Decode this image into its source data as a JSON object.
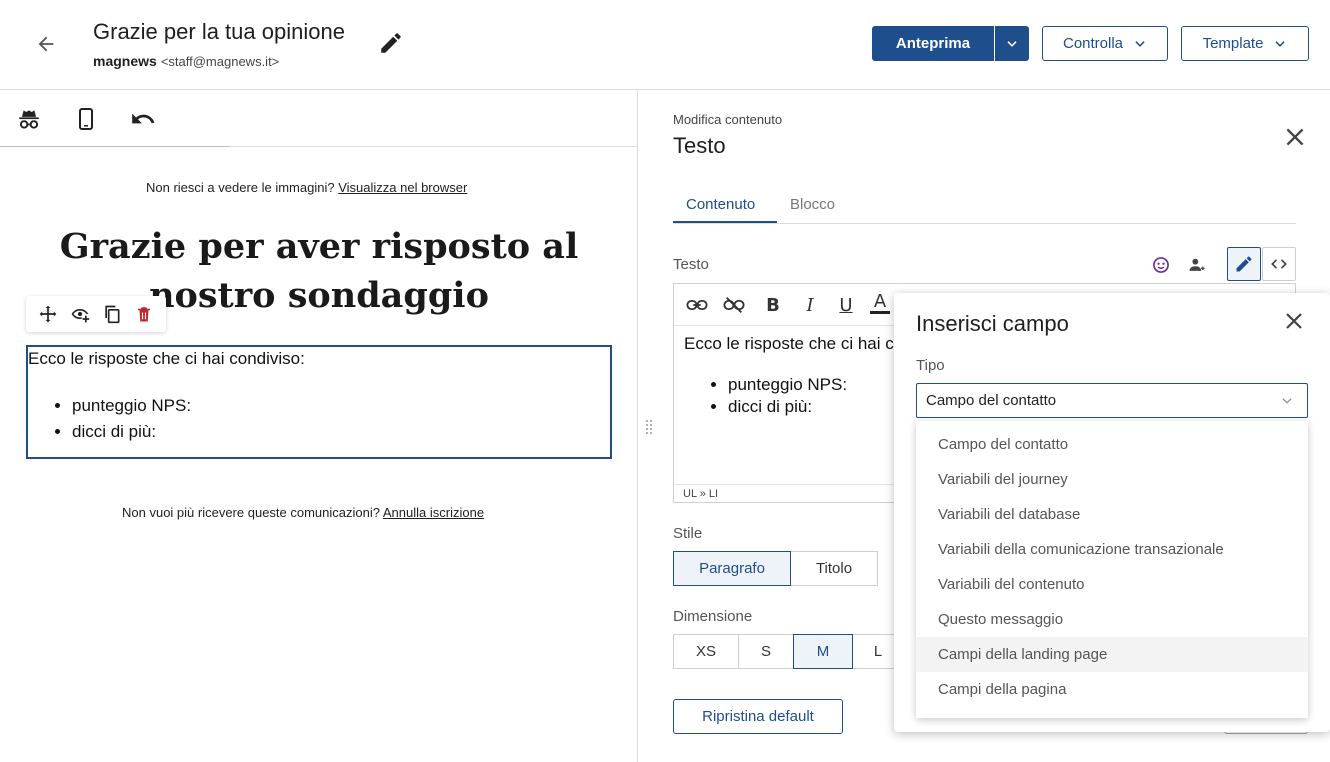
{
  "header": {
    "title": "Grazie per la tua opinione",
    "sender_name": "magnews",
    "sender_email": "<staff@magnews.it>",
    "preview_label": "Anteprima",
    "check_label": "Controlla",
    "template_label": "Template",
    "accent": "#1f4e8c"
  },
  "preview": {
    "browser_text": "Non riesci a vedere le immagini?",
    "browser_link": "Visualizza nel browser",
    "heading": "Grazie per aver risposto al nostro sondaggio",
    "intro": "Ecco le risposte che ci hai condiviso:",
    "items": [
      "punteggio NPS:",
      "dicci di più:"
    ],
    "unsubscribe_text": "Non vuoi più ricevere queste comunicazioni?",
    "unsubscribe_link": "Annulla iscrizione"
  },
  "panel": {
    "subtitle": "Modifica contenuto",
    "title": "Testo",
    "tabs": [
      "Contenuto",
      "Blocco"
    ],
    "text_label": "Testo",
    "editor_intro": "Ecco le risposte che ci hai c",
    "editor_items": [
      "punteggio NPS:",
      "dicci di più:"
    ],
    "editor_path": "UL » LI",
    "style_label": "Stile",
    "style_options": [
      "Paragrafo",
      "Titolo"
    ],
    "size_label": "Dimensione",
    "size_options": [
      "XS",
      "S",
      "M",
      "L"
    ],
    "reset_label": "Ripristina default"
  },
  "popup": {
    "title": "Inserisci campo",
    "type_label": "Tipo",
    "selected": "Campo del contatto",
    "options": [
      "Campo del contatto",
      "Variabili del journey",
      "Variabili del database",
      "Variabili della comunicazione transazionale",
      "Variabili del contenuto",
      "Questo messaggio",
      "Campi della landing page",
      "Campi della pagina"
    ]
  }
}
